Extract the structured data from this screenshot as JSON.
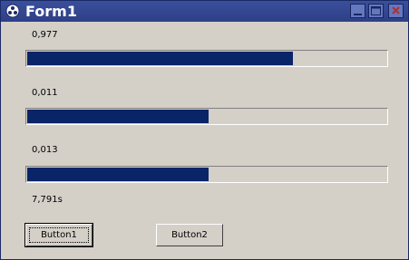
{
  "window": {
    "title": "Form1",
    "colors": {
      "titlebar": "#2e3f86",
      "face": "#d4d0c8",
      "progress_fill": "#0a2468"
    }
  },
  "title_buttons": [
    {
      "icon": "minimize-icon"
    },
    {
      "icon": "maximize-icon"
    },
    {
      "icon": "close-icon"
    }
  ],
  "rows": [
    {
      "value_label": "0,977",
      "progress": 0.74
    },
    {
      "value_label": "0,011",
      "progress": 0.505
    },
    {
      "value_label": "0,013",
      "progress": 0.505
    }
  ],
  "elapsed": "7,791s",
  "buttons": {
    "button1_label": "Button1",
    "button2_label": "Button2"
  }
}
